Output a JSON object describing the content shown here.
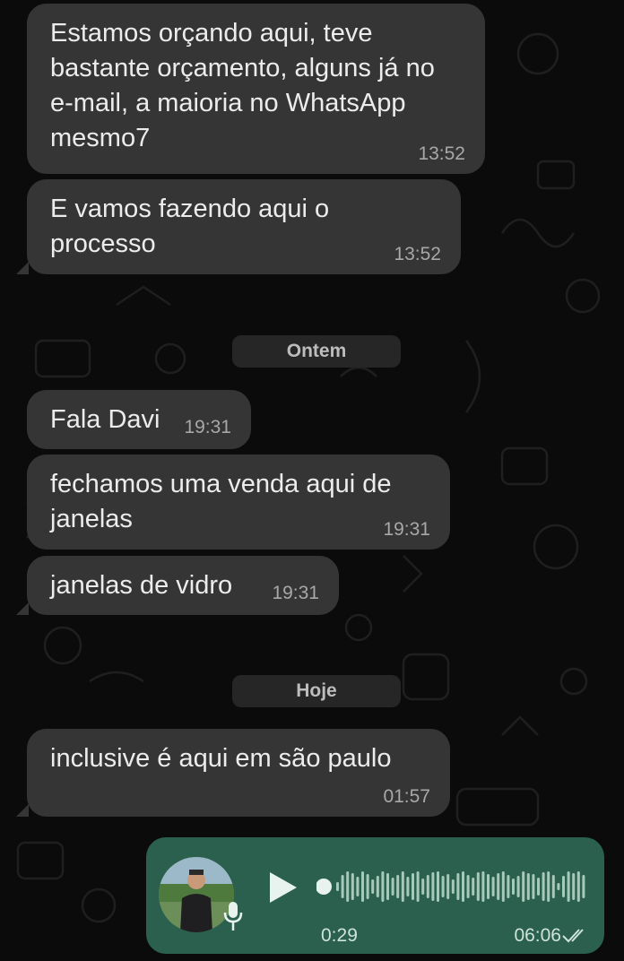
{
  "messages": [
    {
      "text": "Estamos orçando aqui, teve bastante orçamento, alguns já no e-mail, a maioria no WhatsApp mesmo7",
      "time": "13:52"
    },
    {
      "text": "E vamos fazendo aqui o processo",
      "time": "13:52"
    },
    {
      "text": "Fala Davi",
      "time": "19:31"
    },
    {
      "text": "fechamos uma venda aqui de janelas",
      "time": "19:31"
    },
    {
      "text": "janelas de vidro",
      "time": "19:31"
    },
    {
      "text": "inclusive é aqui em são paulo",
      "time": "01:57"
    }
  ],
  "dividers": [
    "Ontem",
    "Hoje"
  ],
  "voice_message": {
    "duration": "0:29",
    "time": "06:06",
    "progress": 0,
    "status": "read"
  },
  "colors": {
    "incoming_bubble": "#353535",
    "outgoing_bubble": "#2a604d",
    "background": "#0b0b0b"
  }
}
